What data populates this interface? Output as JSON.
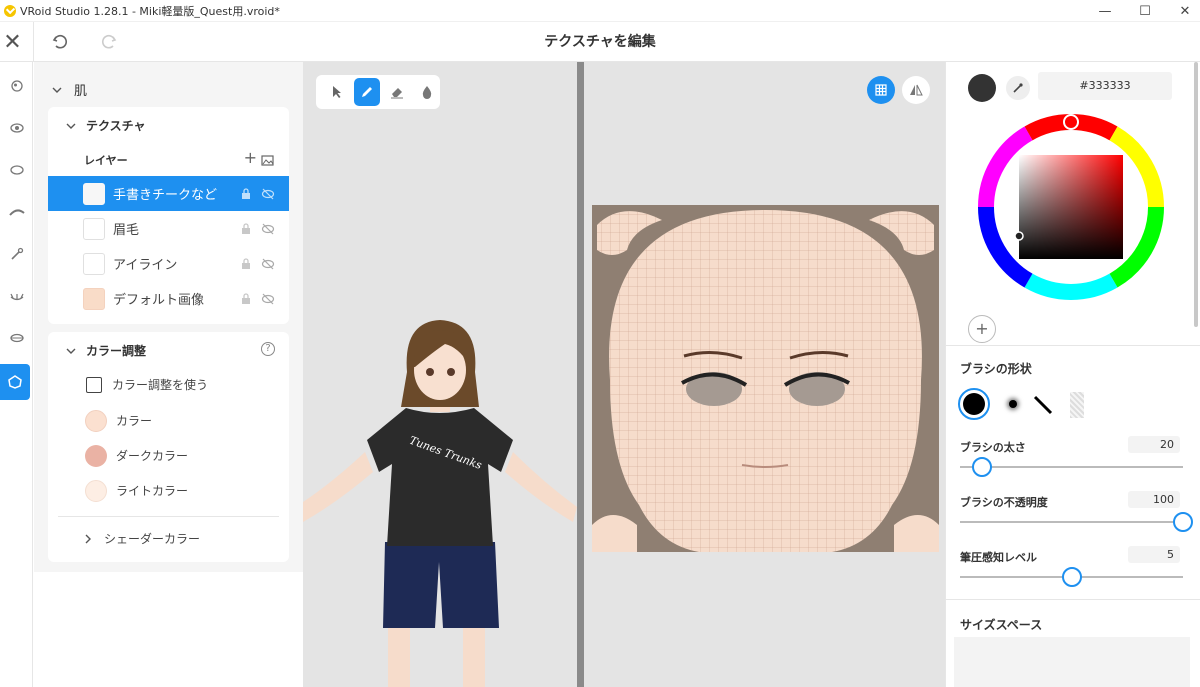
{
  "window": {
    "title": "VRoid Studio 1.28.1 - Miki軽量版_Quest用.vroid*",
    "minimize": "—",
    "maximize": "☐",
    "close": "✕"
  },
  "header": {
    "title": "テクスチャを編集",
    "close_glyph": "✕"
  },
  "rail": {
    "items": [
      "face-icon",
      "eye-icon",
      "ellipse-icon",
      "eyebrow-icon",
      "eyedropper-icon",
      "eyelash-icon",
      "mouth-icon",
      "skin-icon"
    ]
  },
  "panel": {
    "section_title": "肌",
    "texture_title": "テクスチャ",
    "layers_label": "レイヤー",
    "layers": [
      {
        "label": "手書きチークなど",
        "selected": true,
        "thumb": "#f7f7f7"
      },
      {
        "label": "眉毛",
        "selected": false,
        "thumb": "#ffffff"
      },
      {
        "label": "アイライン",
        "selected": false,
        "thumb": "#ffffff"
      },
      {
        "label": "デフォルト画像",
        "selected": false,
        "thumb": "#f9dcc8"
      }
    ],
    "color_adjust_title": "カラー調整",
    "use_color_adjust": "カラー調整を使う",
    "colors": [
      {
        "label": "カラー",
        "color": "#fbe0d0"
      },
      {
        "label": "ダークカラー",
        "color": "#eab2a4"
      },
      {
        "label": "ライトカラー",
        "color": "#fdeee4"
      }
    ],
    "shader_color": "シェーダーカラー"
  },
  "colorpicker": {
    "hex": "#333333",
    "current_color": "#333333",
    "add_glyph": "+"
  },
  "brush": {
    "shape_title": "ブラシの形状",
    "size_label": "ブラシの太さ",
    "size_value": "20",
    "size_fraction": 0.1,
    "opacity_label": "ブラシの不透明度",
    "opacity_value": "100",
    "opacity_fraction": 1.0,
    "pressure_label": "筆圧感知レベル",
    "pressure_value": "5",
    "pressure_fraction": 0.5,
    "size_space_title": "サイズスペース"
  },
  "colors": {
    "accent": "#1e90f0",
    "skin": "#f6dccb",
    "texture_bg": "#8f7f72"
  }
}
